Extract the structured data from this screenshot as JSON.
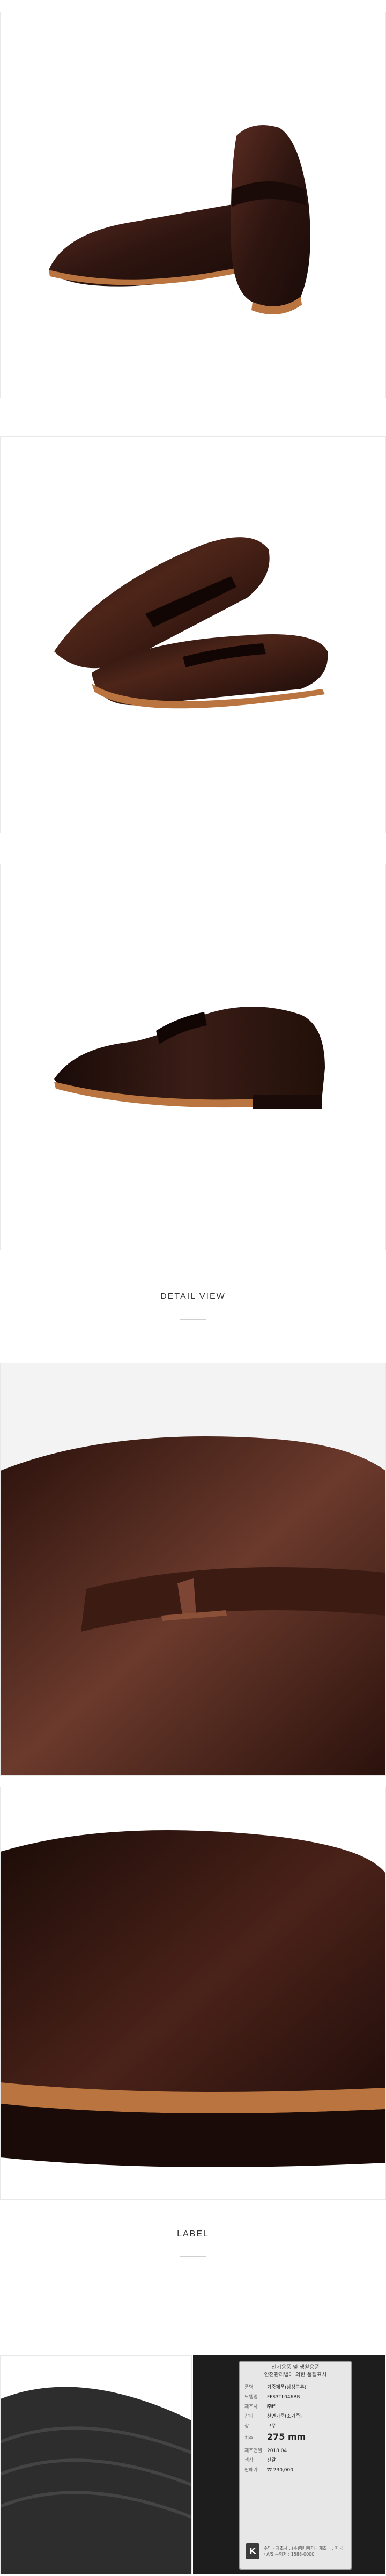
{
  "sections": {
    "detail_view": "DETAIL VIEW",
    "label": "LABEL"
  },
  "label_tag": {
    "title_line1": "전기용품 및 생활용품",
    "title_line2": "안전관리법에 의한 품질표시",
    "rows": [
      {
        "key": "품명",
        "value": "가죽제품(남성구두)"
      },
      {
        "key": "모델명",
        "value": "FFS3TL046BR"
      },
      {
        "key": "제조사",
        "value": "㈜ff"
      },
      {
        "key": "갑피",
        "value": "천연가죽(소가죽)"
      },
      {
        "key": "창",
        "value": "고무"
      },
      {
        "key": "치수",
        "value": "275 mm"
      },
      {
        "key": "제조연월",
        "value": "2018.04"
      },
      {
        "key": "색상",
        "value": "진갈"
      },
      {
        "key": "판매가",
        "value": "₩ 230,000"
      }
    ],
    "kc_mark": "K",
    "kc_text": "수입 · 제조사 : (주)매니에이 · 제조국 : 한국 · A/S 문의처 : 1588-0000"
  },
  "colors": {
    "leather": "#3a1d16",
    "leather_highlight": "#6b3a2c",
    "sole_rim": "#b9743f",
    "background": "#ffffff"
  }
}
